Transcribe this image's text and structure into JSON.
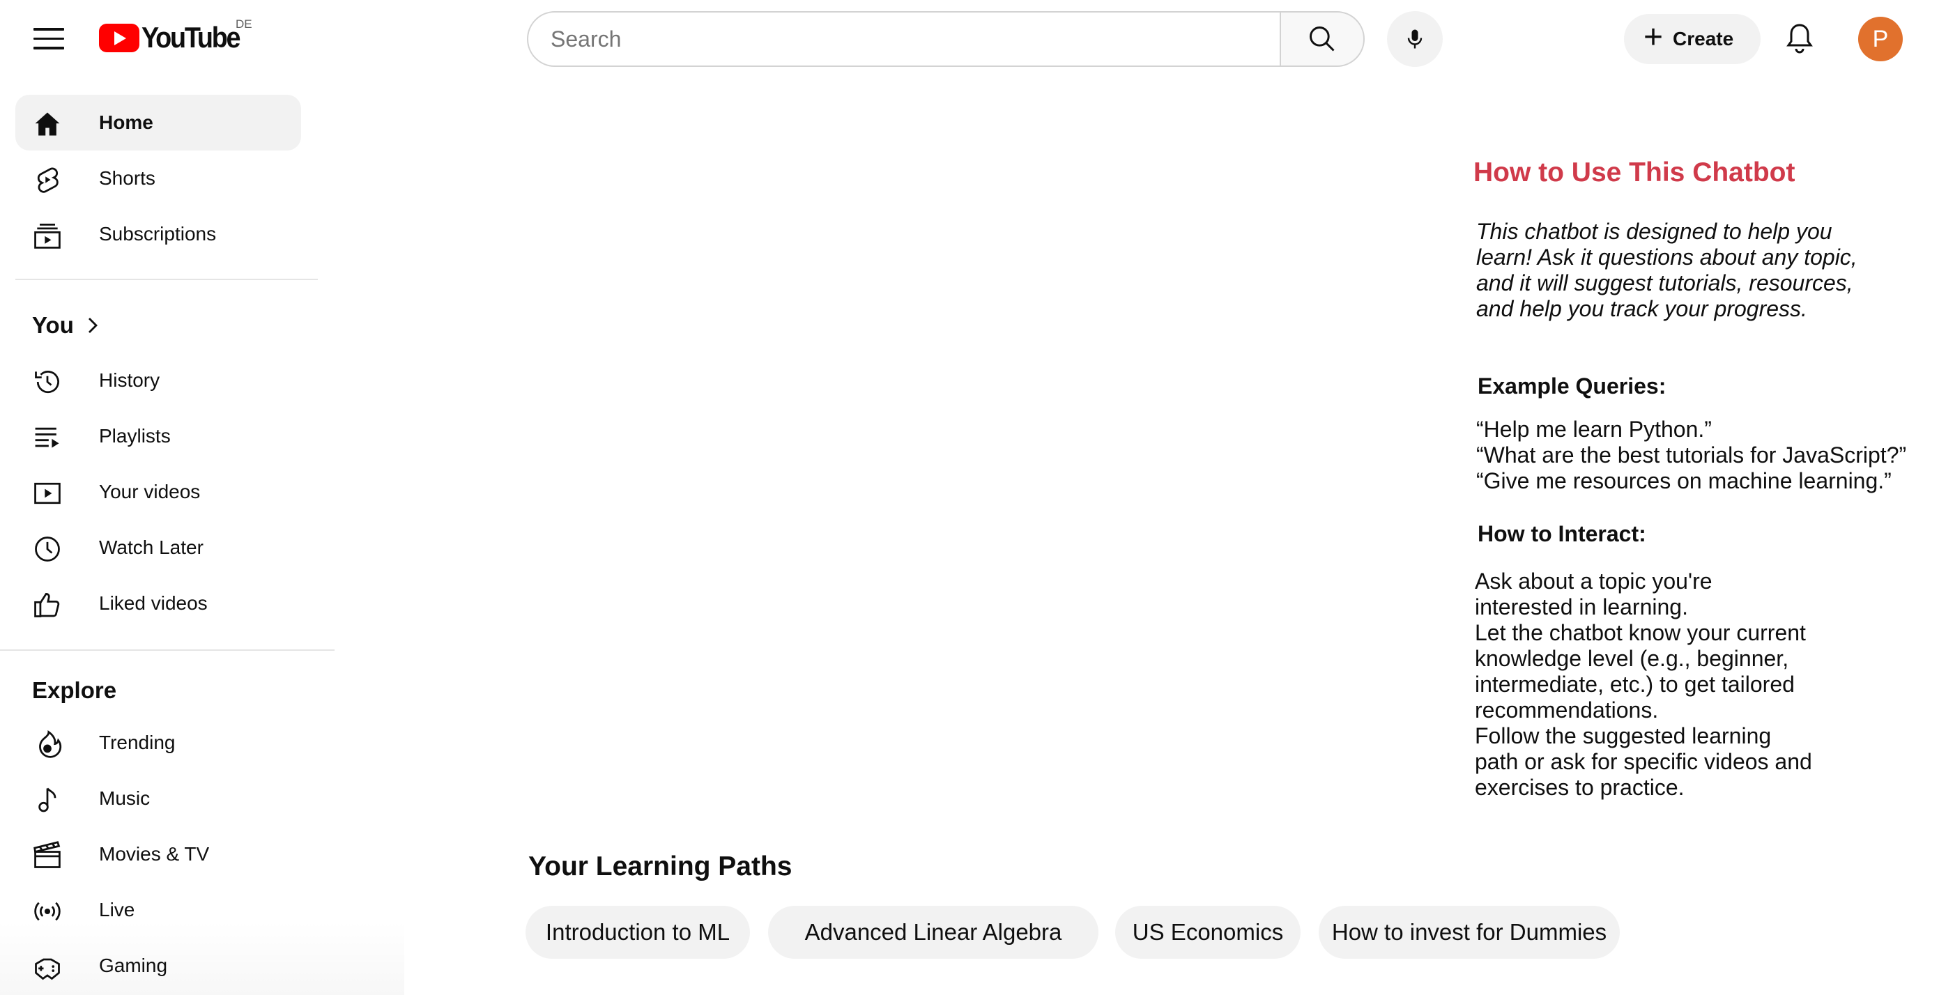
{
  "header": {
    "logo_text": "YouTube",
    "country_code": "DE",
    "search_placeholder": "Search",
    "create_label": "Create",
    "avatar_letter": "P",
    "avatar_color": "#e1712d",
    "brand_color": "#ff0000"
  },
  "sidebar": {
    "main": [
      {
        "label": "Home",
        "icon": "home-icon",
        "active": true
      },
      {
        "label": "Shorts",
        "icon": "shorts-icon"
      },
      {
        "label": "Subscriptions",
        "icon": "subscriptions-icon"
      }
    ],
    "you_title": "You",
    "you": [
      {
        "label": "History",
        "icon": "history-icon"
      },
      {
        "label": "Playlists",
        "icon": "playlists-icon"
      },
      {
        "label": "Your videos",
        "icon": "your-videos-icon"
      },
      {
        "label": "Watch Later",
        "icon": "watch-later-icon"
      },
      {
        "label": "Liked videos",
        "icon": "thumbs-up-icon"
      }
    ],
    "explore_title": "Explore",
    "explore": [
      {
        "label": "Trending",
        "icon": "trending-icon"
      },
      {
        "label": "Music",
        "icon": "music-icon"
      },
      {
        "label": "Movies & TV",
        "icon": "clapperboard-icon"
      },
      {
        "label": "Live",
        "icon": "live-icon"
      },
      {
        "label": "Gaming",
        "icon": "gamepad-icon"
      }
    ]
  },
  "help": {
    "title": "How to Use This Chatbot",
    "title_color": "#d03a4a",
    "intro": "This chatbot is designed to help you learn! Ask it questions about any topic, and it will suggest tutorials, resources, and help you track your progress.",
    "examples_heading": "Example Queries:",
    "examples": [
      "“Help me learn Python.”",
      "“What are the best tutorials for JavaScript?”",
      "“Give me resources on machine learning.”"
    ],
    "interact_heading": "How to Interact:",
    "interact_lines": [
      "Ask about a topic you're",
      "interested in learning.",
      "Let the chatbot know your current",
      "knowledge level (e.g., beginner,",
      "intermediate, etc.) to get tailored",
      "recommendations.",
      "Follow the suggested learning",
      "path or ask for specific videos and",
      "exercises to practice."
    ]
  },
  "learning_paths": {
    "title": "Your Learning Paths",
    "items": [
      "Introduction to ML",
      "Advanced Linear Algebra",
      "US Economics",
      "How to invest for Dummies"
    ]
  }
}
